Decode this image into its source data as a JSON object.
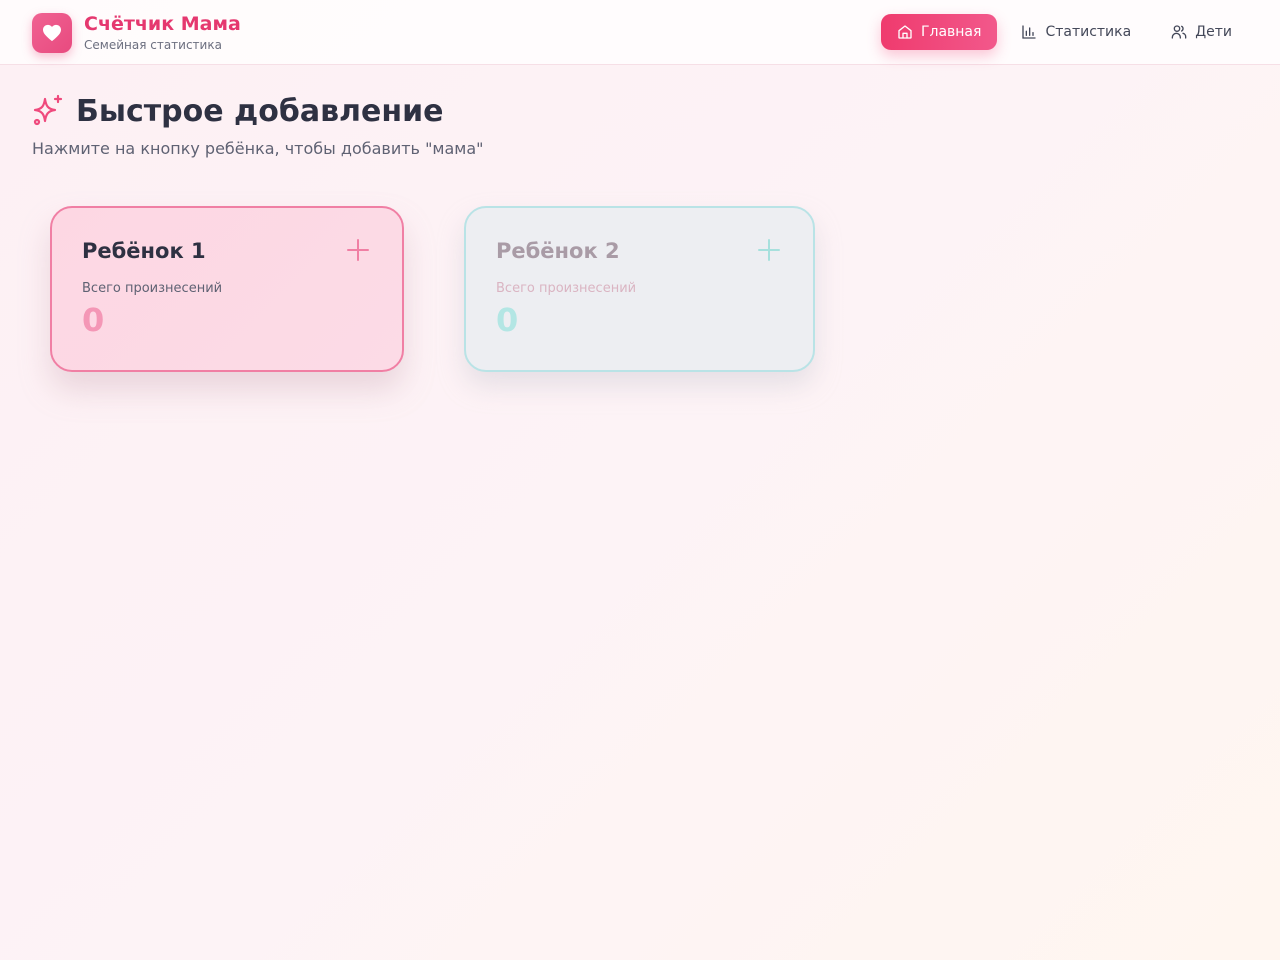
{
  "app": {
    "title": "Счётчик Мама",
    "subtitle": "Семейная статистика",
    "logo_icon": "heart-icon",
    "accent": "#ef3b6e"
  },
  "nav": {
    "items": [
      {
        "label": "Главная",
        "icon": "home-icon",
        "active": true
      },
      {
        "label": "Статистика",
        "icon": "bar-chart-icon",
        "active": false
      },
      {
        "label": "Дети",
        "icon": "users-icon",
        "active": false
      }
    ]
  },
  "main": {
    "title": "Быстрое добавление",
    "title_icon": "sparkles-icon",
    "subtitle": "Нажмите на кнопку ребёнка, чтобы добавить \"мама\""
  },
  "children": [
    {
      "name": "Ребёнок 1",
      "count_label": "Всего произнесений",
      "count": "0",
      "color": "#f07fa4"
    },
    {
      "name": "Ребёнок 2",
      "count_label": "Всего произнесений",
      "count": "0",
      "color": "#b9e3e6"
    }
  ]
}
